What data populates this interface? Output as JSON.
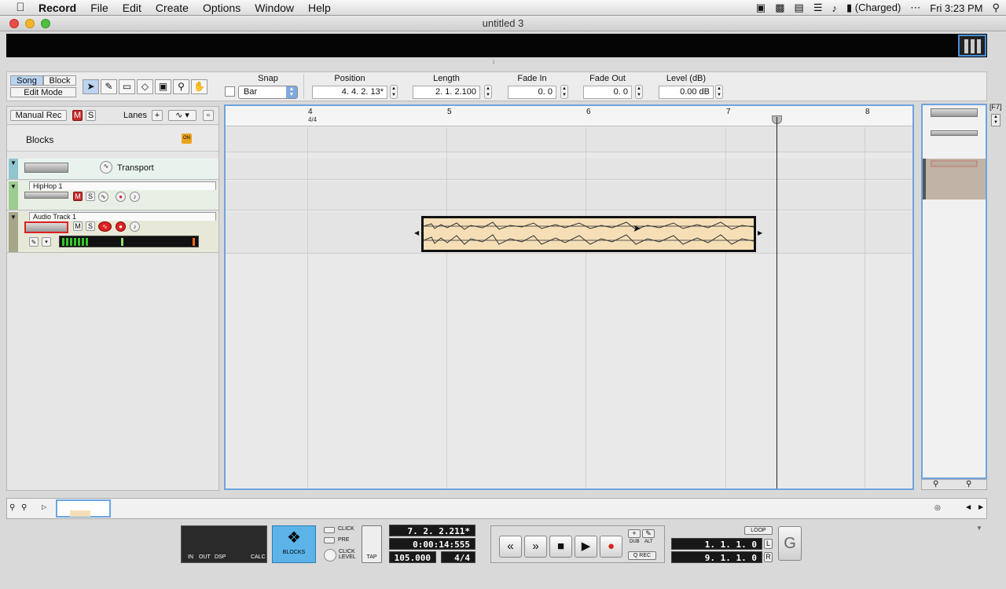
{
  "menubar": {
    "app": "Record",
    "items": [
      "File",
      "Edit",
      "Create",
      "Options",
      "Window",
      "Help"
    ],
    "battery": "(Charged)",
    "clock": "Fri 3:23 PM"
  },
  "window": {
    "title": "untitled 3"
  },
  "toolbar": {
    "mode_song": "Song",
    "mode_block": "Block",
    "edit_mode": "Edit Mode",
    "snap_label": "Snap",
    "snap_value": "Bar",
    "position_label": "Position",
    "position_value": "4. 4. 2. 13*",
    "length_label": "Length",
    "length_value": "2. 1. 2.100",
    "fade_in_label": "Fade In",
    "fade_in_value": "0.   0",
    "fade_out_label": "Fade Out",
    "fade_out_value": "0.   0",
    "level_label": "Level (dB)",
    "level_value": "0.00 dB"
  },
  "left": {
    "manual_rec": "Manual Rec",
    "mute": "M",
    "solo": "S",
    "lanes": "Lanes",
    "blocks": "Blocks",
    "blocks_on": "ON",
    "transport": "Transport",
    "tracks": [
      {
        "name": "HipHop 1"
      },
      {
        "name": "Audio Track 1"
      }
    ]
  },
  "ruler": {
    "bars": [
      "4",
      "5",
      "6",
      "7",
      "8"
    ],
    "signature": "4/4"
  },
  "overview": {
    "key": "F7"
  },
  "transport": {
    "in": "IN",
    "out": "OUT",
    "dsp": "DSP",
    "calc": "CALC",
    "blocks": "BLOCKS",
    "click": "CLICK",
    "pre": "PRE",
    "click_level": "CLICK LEVEL",
    "tap": "TAP",
    "position": "7. 2. 2.211*",
    "time": "0:00:14:555",
    "tempo": "105.000",
    "signature": "4/4",
    "dub": "DUB",
    "alt": "ALT",
    "qrec": "Q REC",
    "loop": "LOOP",
    "left_locator": "1. 1. 1.   0",
    "right_locator": "9. 1. 1.   0",
    "l": "L",
    "r": "R"
  },
  "colors": {
    "accent": "#6da4e0",
    "clip": "#f6dfb6",
    "record": "#d22222"
  }
}
